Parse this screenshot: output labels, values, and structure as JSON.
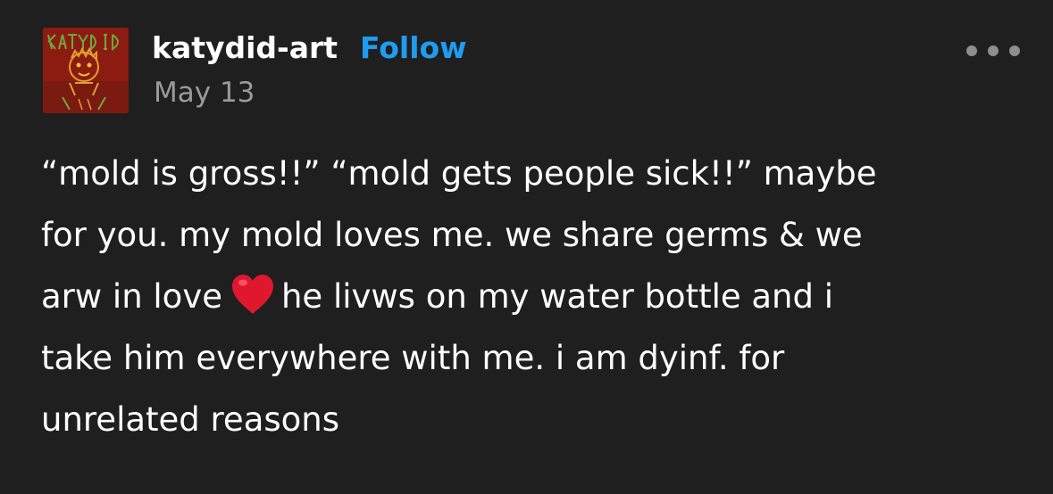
{
  "post": {
    "username": "katydid-art",
    "follow_label": "Follow",
    "date": "May 13",
    "avatar_text": "KATYDID",
    "more_icon": "ellipsis-icon",
    "body": {
      "line1": "“mold is gross!!” “mold gets people sick!!” maybe",
      "line2": "for you. my mold loves me. we share germs & we",
      "line3_before": "arw in love",
      "line3_emoji": "red-heart-emoji",
      "line3_after": "he livws on my water bottle and i",
      "line4": "take him everywhere with me. i am dyinf. for",
      "line5": "unrelated reasons"
    }
  },
  "colors": {
    "background": "#1f1f1f",
    "text": "#ffffff",
    "follow": "#1f9cf0",
    "date": "#9a9a9a",
    "heart": "#e0182d"
  }
}
